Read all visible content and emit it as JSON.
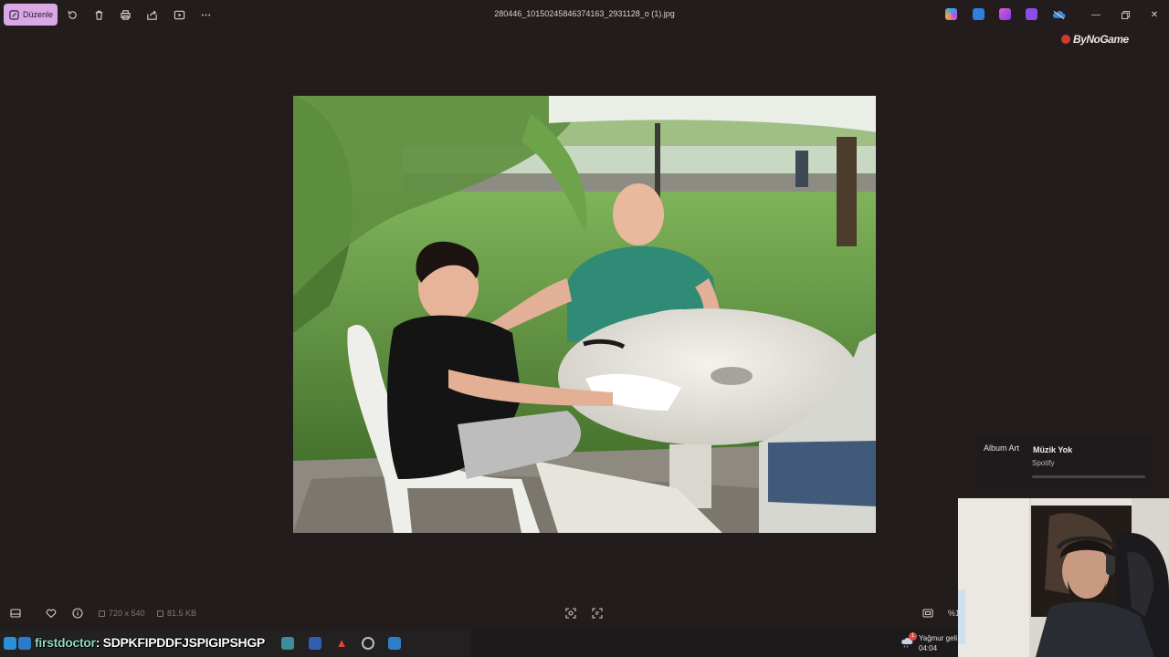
{
  "titlebar": {
    "edit_label": "Düzenle",
    "filename": "280446_10150245846374163_2931128_o (1).jpg",
    "toolbar_icons": [
      "rotate-icon",
      "delete-icon",
      "print-icon",
      "share-icon",
      "slideshow-icon",
      "more-icon"
    ],
    "app_icons": [
      "copilot-icon",
      "paint-icon",
      "designer-icon",
      "clipchamp-icon",
      "onedrive-icon"
    ],
    "window_controls": [
      "minimize-icon",
      "maximize-icon",
      "close-icon"
    ]
  },
  "watermark": "ByNoGame",
  "bottombar": {
    "dimensions": "720 x 540",
    "filesize": "81.5 KB",
    "zoom": "%1"
  },
  "music_widget": {
    "album_art_alt": "Album Art",
    "title": "Müzik Yok",
    "subtitle": "Spotify",
    "progress": 0
  },
  "taskbar": {
    "overlay_user": "firstdoctor",
    "overlay_message": ": SDPKFIPDDFJSPIGIPSHGP",
    "weather_text": "Yağmur geli",
    "notification_count": "1",
    "clock": "04:04"
  },
  "colors": {
    "background": "#231c1d",
    "accent": "#d9a9e6"
  }
}
